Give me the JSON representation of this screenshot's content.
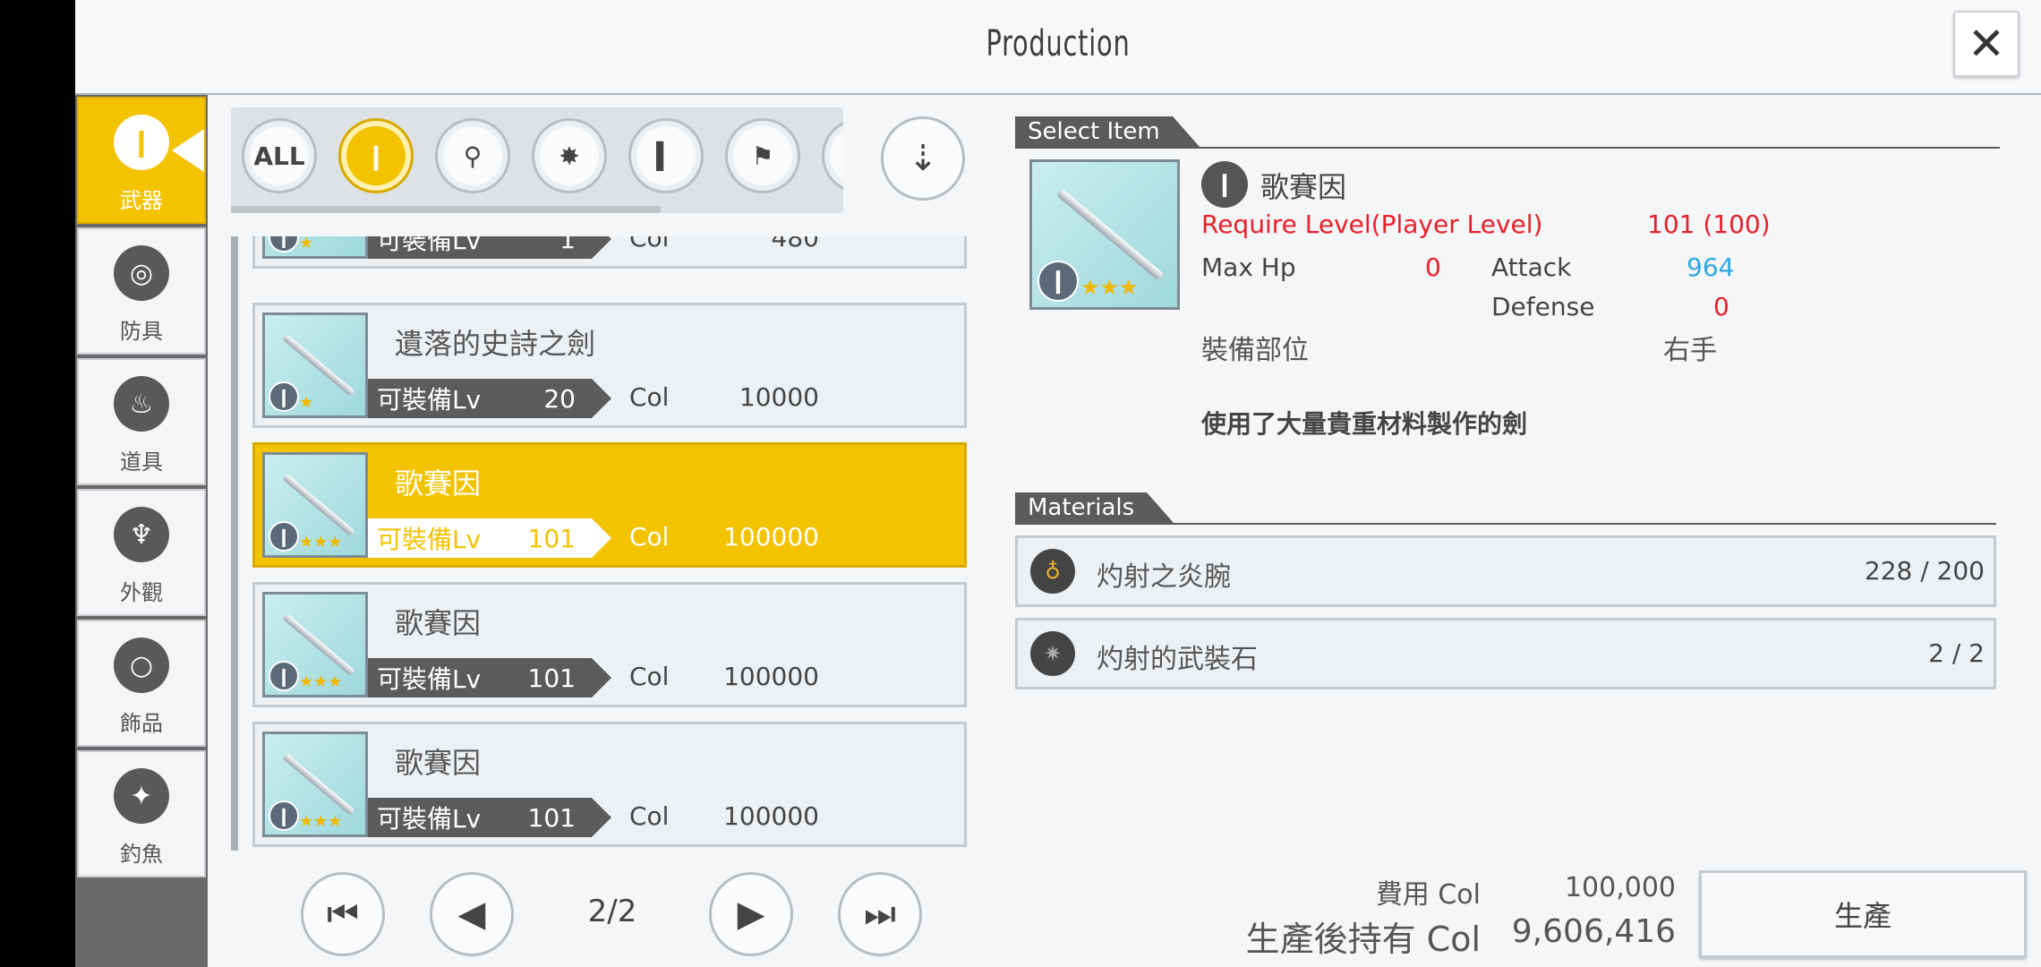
{
  "header": {
    "title": "Production",
    "close_label": "✕"
  },
  "categories": [
    {
      "label": "武器",
      "icon": "sword-icon"
    },
    {
      "label": "防具",
      "icon": "armor-icon"
    },
    {
      "label": "道具",
      "icon": "potion-icon"
    },
    {
      "label": "外觀",
      "icon": "outfit-icon"
    },
    {
      "label": "飾品",
      "icon": "ring-icon"
    },
    {
      "label": "釣魚",
      "icon": "fish-icon"
    }
  ],
  "filters": [
    {
      "label": "ALL",
      "icon": "all-icon"
    },
    {
      "label": "",
      "icon": "one-handed-sword-icon"
    },
    {
      "label": "",
      "icon": "rapier-icon"
    },
    {
      "label": "",
      "icon": "mace-icon"
    },
    {
      "label": "",
      "icon": "dagger-icon"
    },
    {
      "label": "",
      "icon": "axe-icon"
    }
  ],
  "list": {
    "rows": [
      {
        "name": "",
        "lv_label": "可裝備Lv",
        "lv": "1",
        "col_label": "Col",
        "col": "480",
        "stars": "★"
      },
      {
        "name": "遺落的史詩之劍",
        "lv_label": "可裝備Lv",
        "lv": "20",
        "col_label": "Col",
        "col": "10000",
        "stars": "★"
      },
      {
        "name": "歌賽因",
        "lv_label": "可裝備Lv",
        "lv": "101",
        "col_label": "Col",
        "col": "100000",
        "stars": "★★★"
      },
      {
        "name": "歌賽因",
        "lv_label": "可裝備Lv",
        "lv": "101",
        "col_label": "Col",
        "col": "100000",
        "stars": "★★★"
      },
      {
        "name": "歌賽因",
        "lv_label": "可裝備Lv",
        "lv": "101",
        "col_label": "Col",
        "col": "100000",
        "stars": "★★★"
      }
    ]
  },
  "pager": {
    "page": "2/2"
  },
  "detail": {
    "section_title": "Select Item",
    "name": "歌賽因",
    "stars": "★★★",
    "require_label": "Require Level(Player Level)",
    "require_value": "101 (100)",
    "maxhp_label": "Max Hp",
    "maxhp_value": "0",
    "attack_label": "Attack",
    "attack_value": "964",
    "defense_label": "Defense",
    "defense_value": "0",
    "slot_label": "裝備部位",
    "slot_value": "右手",
    "description": "使用了大量貴重材料製作的劍"
  },
  "materials": {
    "section_title": "Materials",
    "items": [
      {
        "name": "灼射之炎腕",
        "qty": "228 / 200",
        "icon": "bag-icon"
      },
      {
        "name": "灼射的武裝石",
        "qty": "2 / 2",
        "icon": "stone-icon"
      }
    ]
  },
  "footer": {
    "cost_label": "費用 Col",
    "cost_value": "100,000",
    "after_label": "生產後持有 Col",
    "after_value": "9,606,416",
    "produce_label": "生產"
  },
  "colors": {
    "accent": "#f3c300",
    "dark": "#5b5b5b",
    "stat_red": "#e8202a",
    "stat_blue": "#30a8e0"
  }
}
